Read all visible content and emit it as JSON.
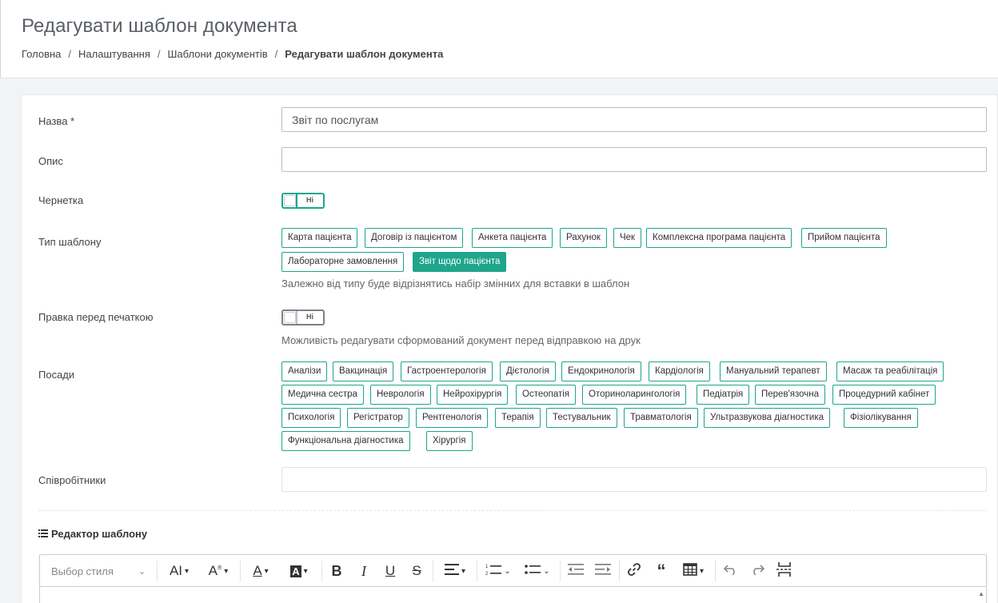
{
  "page": {
    "title": "Редагувати шаблон документа",
    "breadcrumb": [
      "Головна",
      "Налаштування",
      "Шаблони документів",
      "Редагувати шаблон документа"
    ]
  },
  "form": {
    "name": {
      "label": "Назва *",
      "value": "Звіт по послугам"
    },
    "description": {
      "label": "Опис",
      "value": ""
    },
    "draft": {
      "label": "Чернетка",
      "toggle_text": "Ні"
    },
    "template_type": {
      "label": "Тип шаблону",
      "options": [
        "Карта пацієнта",
        "Договір із пацієнтом",
        "Анкета пацієнта",
        "Рахунок",
        "Чек",
        "Комплексна програма пацієнта",
        "Прийом пацієнта",
        "Лабораторне замовлення",
        "Звіт щодо пацієнта"
      ],
      "selected": "Звіт щодо пацієнта",
      "hint": "Залежно від типу буде відрізнятись набір змінних для вставки в шаблон"
    },
    "edit_before_print": {
      "label": "Правка перед печаткою",
      "toggle_text": "Ні",
      "hint": "Можливість редагувати сформований документ перед відправкою на друк"
    },
    "positions": {
      "label": "Посади",
      "options": [
        "Аналізи",
        "Вакцинація",
        "Гастроентерологія",
        "Дієтологія",
        "Ендокринологія",
        "Кардіологія",
        "Мануальний терапевт",
        "Масаж та реабілітація",
        "Медична сестра",
        "Неврологія",
        "Нейрохірургія",
        "Остеопатія",
        "Оториноларингологія",
        "Педіатрія",
        "Перев'язочна",
        "Процедурний кабінет",
        "Психологія",
        "Регістратор",
        "Рентгенологія",
        "Терапія",
        "Тестувальник",
        "Травматологія",
        "Ультразвукова діагностика",
        "Фізіолікування",
        "Функціональна діагностика",
        "Хірургія"
      ]
    },
    "employees": {
      "label": "Співробітники",
      "value": ""
    }
  },
  "editor": {
    "title": "Редактор шаблону",
    "style_placeholder": "Выбор стиля",
    "icons": {
      "font_size": "AI",
      "font_family": "A",
      "font_color": "A",
      "bg_color": "A",
      "bold": "B",
      "italic": "I",
      "underline": "U",
      "strike": "S"
    }
  },
  "colors": {
    "accent": "#1ea58c"
  }
}
